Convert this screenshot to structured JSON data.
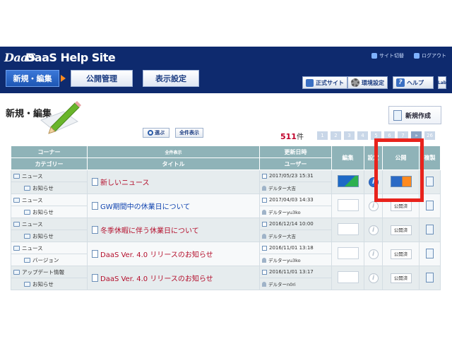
{
  "header": {
    "logo_mark": "DaaS",
    "site_title": "DaaS Help Site",
    "sitemap_link": "サイト切替",
    "logout_link": "ログアウト",
    "tabs": [
      {
        "label": "新規・編集"
      },
      {
        "label": "公開管理"
      },
      {
        "label": "表示設定"
      }
    ],
    "buttons": {
      "official_site": "正式サイト",
      "env_settings": "環境設定",
      "help": "ヘルプ",
      "narrow": "Lab"
    }
  },
  "page": {
    "section_title": "新規・編集",
    "new_button": "新規作成",
    "search_button": "選ぶ",
    "show_all_button": "全件表示",
    "count_number": "511",
    "count_unit": "件",
    "pages": [
      "1",
      "2",
      "3",
      "4",
      "5",
      "6",
      "7",
      "»",
      "26"
    ]
  },
  "table": {
    "headers": {
      "corner": "コーナー",
      "category": "カテゴリー",
      "all_display": "全件表示",
      "title": "タイトル",
      "updated": "更新日時",
      "user": "ユーザー",
      "edit": "編集",
      "settings": "設定",
      "publish": "公開",
      "copy": "複製"
    },
    "rows": [
      {
        "corner": "ニュース",
        "category": "お知らせ",
        "title": "新しいニュース",
        "title_color": "red",
        "date": "2017/05/23 15:31",
        "user": "デルター大吉",
        "active": true
      },
      {
        "corner": "ニュース",
        "category": "お知らせ",
        "title": "GW期間中の休業日について",
        "title_color": "blue",
        "date": "2017/04/03 14:33",
        "user": "デルターyu3ko",
        "active": false
      },
      {
        "corner": "ニュース",
        "category": "お知らせ",
        "title": "冬季休暇に伴う休業日について",
        "title_color": "red",
        "date": "2016/12/14 10:00",
        "user": "デルター大吉",
        "active": false
      },
      {
        "corner": "ニュース",
        "category": "バージョン",
        "title": "DaaS Ver. 4.0 リリースのお知らせ",
        "title_color": "red",
        "date": "2016/11/01 13:18",
        "user": "デルターyu3ko",
        "active": false
      },
      {
        "corner": "アップデート情報",
        "category": "お知らせ",
        "title": "DaaS Ver. 4.0 リリースのお知らせ",
        "title_color": "red",
        "date": "2016/11/01 13:17",
        "user": "デルターn0ri",
        "active": false
      }
    ],
    "publish_label": "公開済"
  },
  "colors": {
    "header_bg": "#0e2a6e",
    "table_header": "#8fb3b8",
    "highlight": "#e8231c",
    "title_red": "#b40f2c",
    "title_blue": "#1245b0"
  }
}
